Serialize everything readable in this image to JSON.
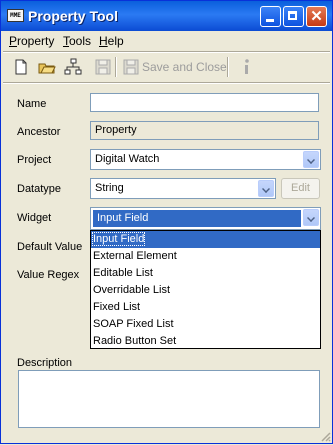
{
  "window": {
    "title": "Property Tool",
    "app_icon_text": "MME"
  },
  "menubar": {
    "items": [
      {
        "first": "P",
        "rest": "roperty"
      },
      {
        "first": "T",
        "rest": "ools"
      },
      {
        "first": "H",
        "rest": "elp"
      }
    ]
  },
  "toolbar": {
    "save_and_close_label": "Save and Close"
  },
  "form": {
    "name_label": "Name",
    "name_value": "",
    "ancestor_label": "Ancestor",
    "ancestor_value": "Property",
    "project_label": "Project",
    "project_value": "Digital Watch",
    "datatype_label": "Datatype",
    "datatype_value": "String",
    "edit_label": "Edit",
    "widget_label": "Widget",
    "widget_value": "Input Field",
    "default_value_label": "Default Value",
    "value_regex_label": "Value Regex",
    "description_label": "Description",
    "description_value": ""
  },
  "widget_options": [
    "Input Field",
    "External Element",
    "Editable List",
    "Overridable List",
    "Fixed List",
    "SOAP Fixed List",
    "Radio Button Set"
  ]
}
